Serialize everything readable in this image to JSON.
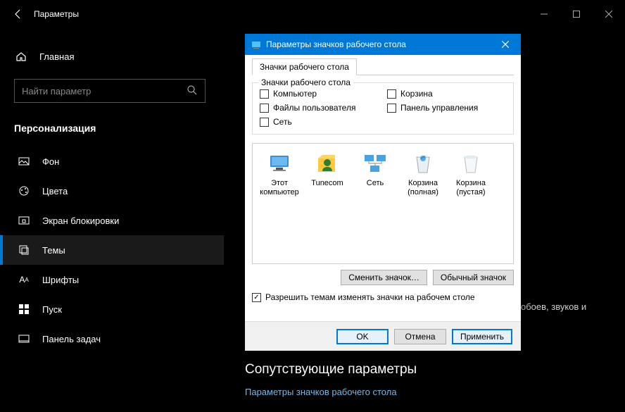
{
  "titlebar": {
    "title": "Параметры"
  },
  "sidebar": {
    "home": "Главная",
    "search_placeholder": "Найти параметр",
    "category": "Персонализация",
    "items": [
      {
        "label": "Фон"
      },
      {
        "label": "Цвета"
      },
      {
        "label": "Экран блокировки"
      },
      {
        "label": "Темы"
      },
      {
        "label": "Шрифты"
      },
      {
        "label": "Пуск"
      },
      {
        "label": "Панель задач"
      }
    ]
  },
  "overflow_text": "обоев, звуков и",
  "related": {
    "heading": "Сопутствующие параметры",
    "link": "Параметры значков рабочего стола"
  },
  "dialog": {
    "title": "Параметры значков рабочего стола",
    "tab": "Значки рабочего стола",
    "group_label": "Значки рабочего стола",
    "checkboxes": [
      {
        "label": "Компьютер",
        "checked": false
      },
      {
        "label": "Корзина",
        "checked": false
      },
      {
        "label": "Файлы пользователя",
        "checked": false
      },
      {
        "label": "Панель управления",
        "checked": false
      },
      {
        "label": "Сеть",
        "checked": false
      }
    ],
    "icons": [
      {
        "label": "Этот компьютер",
        "kind": "pc"
      },
      {
        "label": "Tunecom",
        "kind": "user"
      },
      {
        "label": "Сеть",
        "kind": "net"
      },
      {
        "label": "Корзина (полная)",
        "kind": "bin-full"
      },
      {
        "label": "Корзина (пустая)",
        "kind": "bin-empty"
      }
    ],
    "change_btn": "Сменить значок…",
    "default_btn": "Обычный значок",
    "allow_themes": {
      "label": "Разрешить темам изменять значки на рабочем столе",
      "checked": true
    },
    "ok": "OK",
    "cancel": "Отмена",
    "apply": "Применить"
  }
}
